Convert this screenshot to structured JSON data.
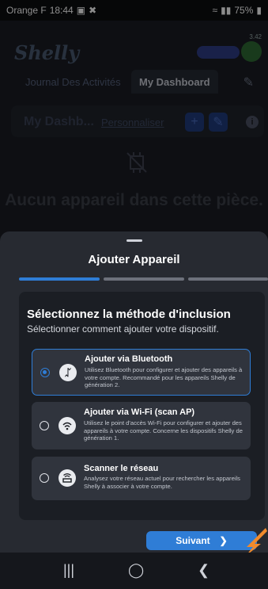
{
  "status_bar": {
    "carrier": "Orange F",
    "time": "18:44",
    "battery": "75%"
  },
  "app": {
    "logo": "Shelly",
    "version": "3.42",
    "tabs": [
      {
        "label": "Journal Des Activités"
      },
      {
        "label": "My Dashboard"
      }
    ],
    "dashboard_title": "My Dashb...",
    "personalize_label": "Personnaliser",
    "empty_message": "Aucun appareil dans cette pièce."
  },
  "sheet": {
    "title": "Ajouter Appareil",
    "step_current": 1,
    "step_total": 3,
    "card_title": "Sélectionnez la méthode d'inclusion",
    "card_subtitle": "Sélectionner comment ajouter votre dispositif.",
    "options": [
      {
        "title": "Ajouter via Bluetooth",
        "description": "Utilisez Bluetooth pour configurer et ajouter des appareils à votre compte. Recommandé pour les appareils Shelly de génération 2.",
        "icon": "bluetooth-icon",
        "selected": true
      },
      {
        "title": "Ajouter via Wi-Fi (scan AP)",
        "description": "Utilisez le point d'accès Wi-Fi pour configurer et ajouter des appareils à votre compte. Concerne les dispositifs Shelly de génération 1.",
        "icon": "wifi-icon",
        "selected": false
      },
      {
        "title": "Scanner le réseau",
        "description": "Analysez votre réseau actuel pour rechercher les appareils Shelly à associer à votre compte.",
        "icon": "router-icon",
        "selected": false
      }
    ],
    "next_label": "Suivant"
  },
  "colors": {
    "accent": "#2f7dd6",
    "arrow": "#f08a2c",
    "sheet": "#272a31"
  }
}
